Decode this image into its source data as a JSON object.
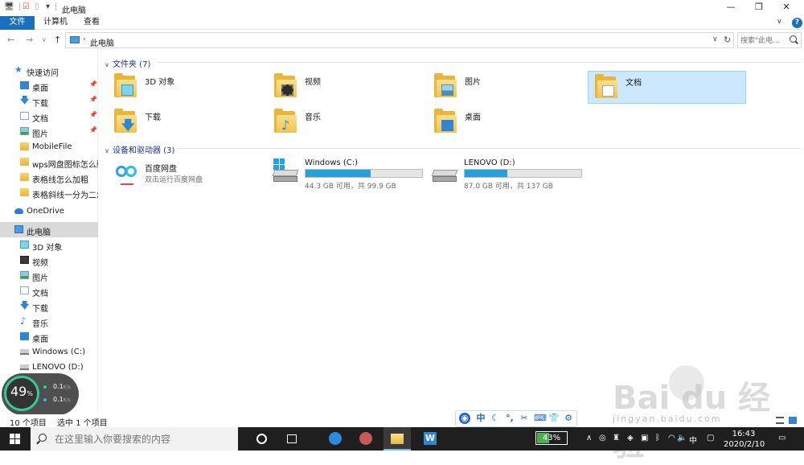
{
  "window": {
    "title": "此电脑",
    "controls": [
      "minimize",
      "restore",
      "close"
    ]
  },
  "ribbon": {
    "tabs": [
      "文件",
      "计算机",
      "查看"
    ],
    "help": "?"
  },
  "address": {
    "path": "此电脑",
    "search_placeholder": "搜索\"此电..."
  },
  "sidebar": {
    "quick_access": "快速访问",
    "quick_items": [
      {
        "label": "桌面",
        "icon": "desktop-icon",
        "pinned": true
      },
      {
        "label": "下载",
        "icon": "download-icon",
        "pinned": true
      },
      {
        "label": "文档",
        "icon": "document-icon",
        "pinned": true
      },
      {
        "label": "图片",
        "icon": "picture-icon",
        "pinned": true
      },
      {
        "label": "MobileFile",
        "icon": "folder-icon",
        "pinned": false
      },
      {
        "label": "wps网盘图标怎么删",
        "icon": "folder-icon",
        "pinned": false
      },
      {
        "label": "表格线怎么加粗",
        "icon": "folder-icon",
        "pinned": false
      },
      {
        "label": "表格斜线一分为二怎",
        "icon": "folder-icon",
        "pinned": false
      }
    ],
    "onedrive": "OneDrive",
    "this_pc": "此电脑",
    "pc_items": [
      {
        "label": "3D 对象",
        "icon": "3d-objects-icon"
      },
      {
        "label": "视频",
        "icon": "video-icon"
      },
      {
        "label": "图片",
        "icon": "picture-icon"
      },
      {
        "label": "文档",
        "icon": "document-icon"
      },
      {
        "label": "下载",
        "icon": "download-icon"
      },
      {
        "label": "音乐",
        "icon": "music-icon"
      },
      {
        "label": "桌面",
        "icon": "desktop-icon"
      },
      {
        "label": "Windows (C:)",
        "icon": "drive-icon"
      },
      {
        "label": "LENOVO (D:)",
        "icon": "drive-icon"
      }
    ]
  },
  "main": {
    "folders_header": "文件夹 (7)",
    "folders": [
      {
        "name": "3D 对象",
        "icon": "3d-objects-folder-icon",
        "selected": false
      },
      {
        "name": "视频",
        "icon": "video-folder-icon",
        "selected": false
      },
      {
        "name": "图片",
        "icon": "pictures-folder-icon",
        "selected": false
      },
      {
        "name": "文档",
        "icon": "documents-folder-icon",
        "selected": true
      },
      {
        "name": "下载",
        "icon": "downloads-folder-icon",
        "selected": false
      },
      {
        "name": "音乐",
        "icon": "music-folder-icon",
        "selected": false
      },
      {
        "name": "桌面",
        "icon": "desktop-folder-icon",
        "selected": false
      }
    ],
    "devices_header": "设备和驱动器 (3)",
    "baidu": {
      "name": "百度网盘",
      "sub": "双击运行百度网盘"
    },
    "drives": [
      {
        "name": "Windows (C:)",
        "info": "44.3 GB 可用，共 99.9 GB",
        "used_fraction": 0.557
      },
      {
        "name": "LENOVO (D:)",
        "info": "87.0 GB 可用，共 137 GB",
        "used_fraction": 0.365
      }
    ]
  },
  "status": {
    "count": "10 个项目",
    "selected": "选中 1 个项目"
  },
  "net_widget": {
    "percent": "49",
    "percent_unit": "%",
    "upload": "0.1",
    "download": "0.1",
    "rate_unit": "K/s"
  },
  "ime_bar": {
    "lang": "中",
    "icons": [
      "ime-logo-icon",
      "chinese-mode-icon",
      "moon-icon",
      "punctuation-icon",
      "scissors-icon",
      "keyboard-icon",
      "shirt-icon",
      "settings-icon"
    ]
  },
  "taskbar": {
    "search_placeholder": "在这里输入你要搜索的内容",
    "battery": "43%",
    "battery_fraction": 0.43,
    "ime": "中",
    "time": "16:43",
    "date": "2020/2/10"
  },
  "watermark": {
    "text": "Bai du 经验",
    "url": "jingyan.baidu.com"
  },
  "colors": {
    "accent": "#1a6fbf",
    "selection": "#cce8ff",
    "drive_fill": "#26a0da",
    "taskbar": "#1f1f1f"
  }
}
